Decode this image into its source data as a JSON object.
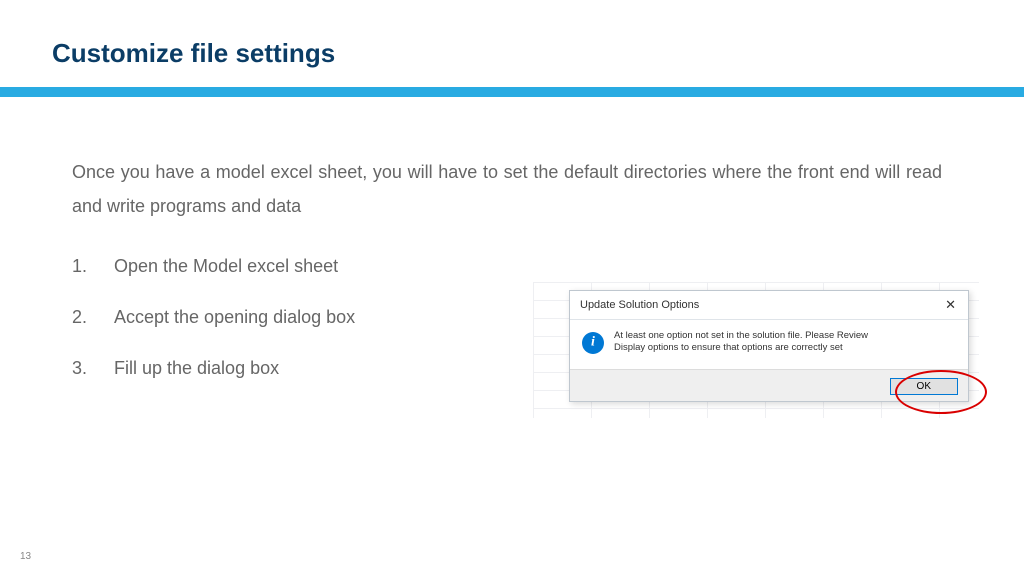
{
  "header": {
    "title": "Customize file settings"
  },
  "intro": "Once you have a model excel sheet, you will have to set the default directories where the front end will read and write programs and data",
  "steps": [
    "Open the Model excel sheet",
    "Accept the opening dialog box",
    "Fill up the dialog box"
  ],
  "dialog": {
    "title": "Update Solution Options",
    "message_line1": "At least one option not set in the solution file. Please Review",
    "message_line2": "Display options to ensure that options are correctly set",
    "ok_label": "OK"
  },
  "page_number": "13"
}
